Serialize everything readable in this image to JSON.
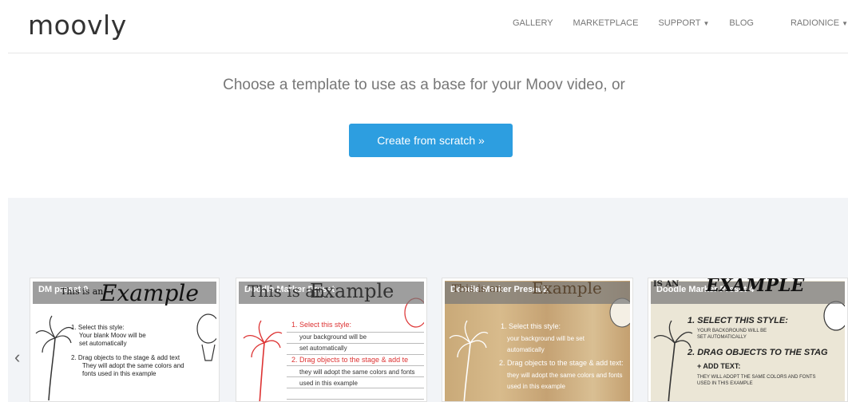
{
  "brand": {
    "logo": "moovly"
  },
  "nav": {
    "items": [
      {
        "label": "GALLERY"
      },
      {
        "label": "MARKETPLACE"
      },
      {
        "label": "SUPPORT"
      },
      {
        "label": "BLOG"
      },
      {
        "label": "RADIONICE"
      }
    ]
  },
  "hero": {
    "headline": "Choose a template to use as a base for your Moov video, or",
    "cta_label": "Create from scratch »"
  },
  "carousel": {
    "prev_icon": "‹",
    "cards": [
      {
        "title": "DM preset 0",
        "example": "Example",
        "overlay_prefix": "This is an",
        "lines": [
          "1. Select this style:",
          "Your blank Moov will be",
          "set automatically",
          "2. Drag objects to the stage & add text",
          "They will adopt the same colors and",
          "fonts used in this example"
        ]
      },
      {
        "title": "Doodle Marker Preset",
        "example": "Example",
        "overlay_prefix": "This is an",
        "lines": [
          "1. Select this style:",
          "your background will be",
          "set automatically",
          "2. Drag objects to the stage & add te",
          "they will adopt the same colors and fonts",
          "used in this example"
        ]
      },
      {
        "title": "Doodle Marker Preset 2",
        "example": "Example",
        "overlay_prefix": "This is an",
        "lines": [
          "1. Select this style:",
          "your background will be set",
          "automatically",
          "2. Drag objects to the stage & add text:",
          "they will adopt the same colors and fonts",
          "used in this example"
        ]
      },
      {
        "title": "Doodle Marker Preset 4",
        "example": "EXAMPLE",
        "overlay_prefix": "IS AN",
        "lines": [
          "1. SELECT THIS STYLE:",
          "YOUR BACKGROUND WILL BE",
          "SET AUTOMATICALLY",
          "2. DRAG OBJECTS TO THE STAG",
          "+ ADD TEXT:",
          "THEY WILL ADOPT THE SAME COLORS AND FONTS",
          "USED IN THIS EXAMPLE"
        ]
      }
    ]
  },
  "colors": {
    "accent": "#2d9ee0",
    "nav_text": "#777777",
    "gallery_bg": "#f2f4f7"
  }
}
